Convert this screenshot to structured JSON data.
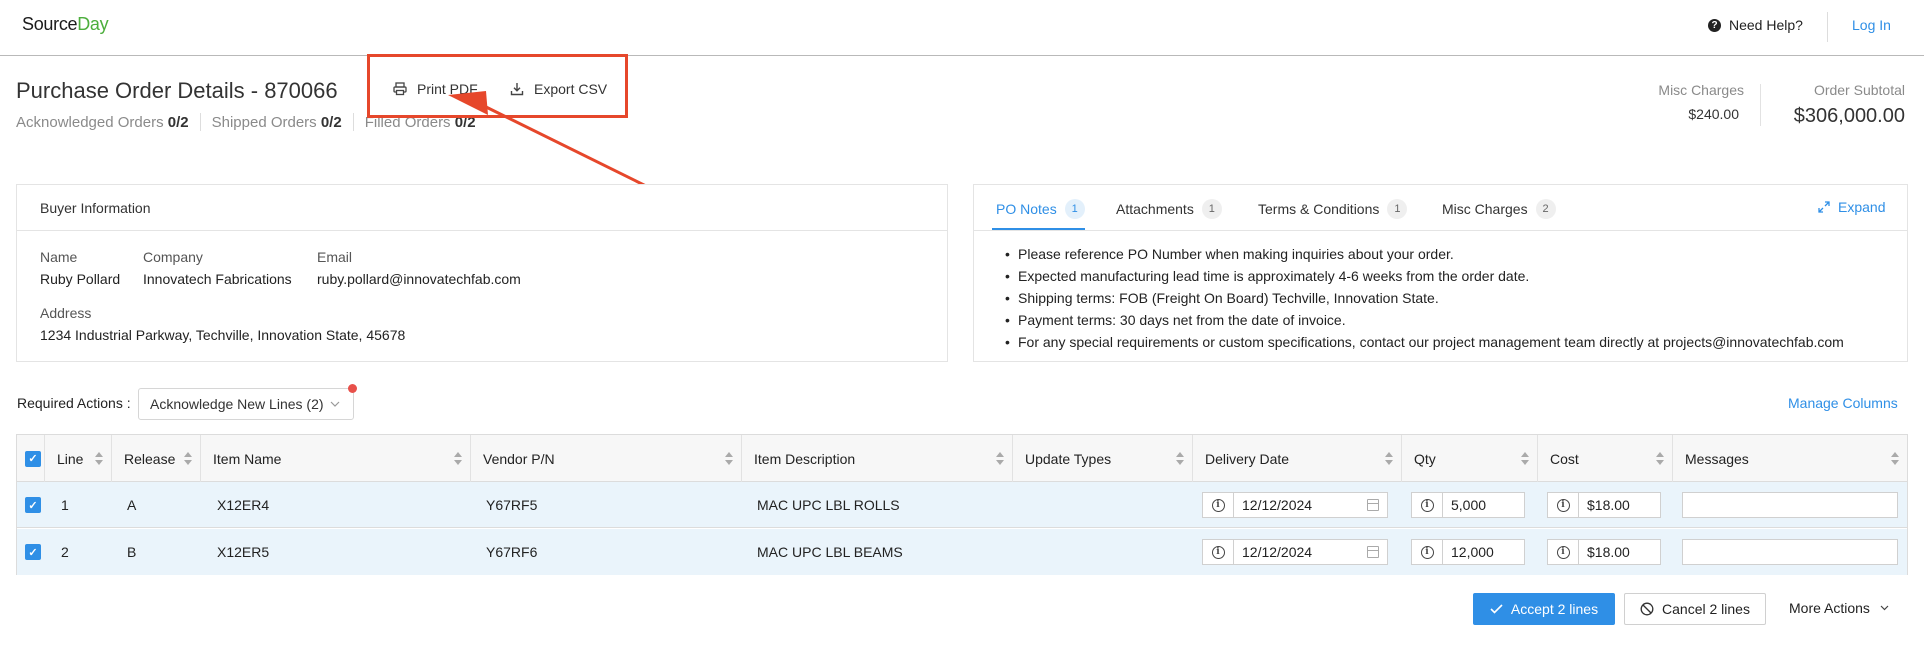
{
  "brand": {
    "source": "Source",
    "day": "Day"
  },
  "header": {
    "help_label": "Need Help?",
    "login_label": "Log In"
  },
  "page": {
    "title": "Purchase Order Details - 870066",
    "stats": [
      {
        "label": "Acknowledged Orders",
        "value": "0/2"
      },
      {
        "label": "Shipped Orders",
        "value": "0/2"
      },
      {
        "label": "Filled Orders",
        "value": "0/2"
      }
    ],
    "print_label": "Print PDF",
    "export_label": "Export CSV",
    "misc_charges_label": "Misc Charges",
    "misc_charges_value": "$240.00",
    "subtotal_label": "Order Subtotal",
    "subtotal_value": "$306,000.00"
  },
  "buyer": {
    "heading": "Buyer Information",
    "name_label": "Name",
    "name_value": "Ruby Pollard",
    "company_label": "Company",
    "company_value": "Innovatech Fabrications",
    "email_label": "Email",
    "email_value": "ruby.pollard@innovatechfab.com",
    "address_label": "Address",
    "address_value": "1234 Industrial Parkway, Techville, Innovation State, 45678"
  },
  "tabs": [
    {
      "label": "PO Notes",
      "count": "1"
    },
    {
      "label": "Attachments",
      "count": "1"
    },
    {
      "label": "Terms & Conditions",
      "count": "1"
    },
    {
      "label": "Misc Charges",
      "count": "2"
    }
  ],
  "expand_label": "Expand",
  "notes": [
    "Please reference PO Number when making inquiries about your order.",
    "Expected manufacturing lead time is approximately 4-6 weeks from the order date.",
    "Shipping terms: FOB (Freight On Board) Techville, Innovation State.",
    "Payment terms: 30 days net from the date of invoice.",
    "For any special requirements or custom specifications, contact our project management team directly at projects@innovatechfab.com"
  ],
  "actions": {
    "required_label": "Required Actions :",
    "acknowledge_select": "Acknowledge New Lines (2)",
    "manage_columns": "Manage Columns"
  },
  "table": {
    "columns": [
      "Line",
      "Release",
      "Item Name",
      "Vendor P/N",
      "Item Description",
      "Update Types",
      "Delivery Date",
      "Qty",
      "Cost",
      "Messages"
    ],
    "rows": [
      {
        "line": "1",
        "release": "A",
        "item": "X12ER4",
        "vendor": "Y67RF5",
        "desc": "MAC UPC LBL ROLLS",
        "date": "12/12/2024",
        "qty": "5,000",
        "cost": "$18.00",
        "message": ""
      },
      {
        "line": "2",
        "release": "B",
        "item": "X12ER5",
        "vendor": "Y67RF6",
        "desc": "MAC UPC LBL BEAMS",
        "date": "12/12/2024",
        "qty": "12,000",
        "cost": "$18.00",
        "message": ""
      }
    ]
  },
  "footer": {
    "accept_label": "Accept 2 lines",
    "cancel_label": "Cancel 2 lines",
    "more_label": "More Actions"
  },
  "colors": {
    "accent": "#2f8fe6",
    "brand_green": "#4cae3c",
    "annotation": "#e6472b",
    "row_selected": "#eaf4fb"
  }
}
